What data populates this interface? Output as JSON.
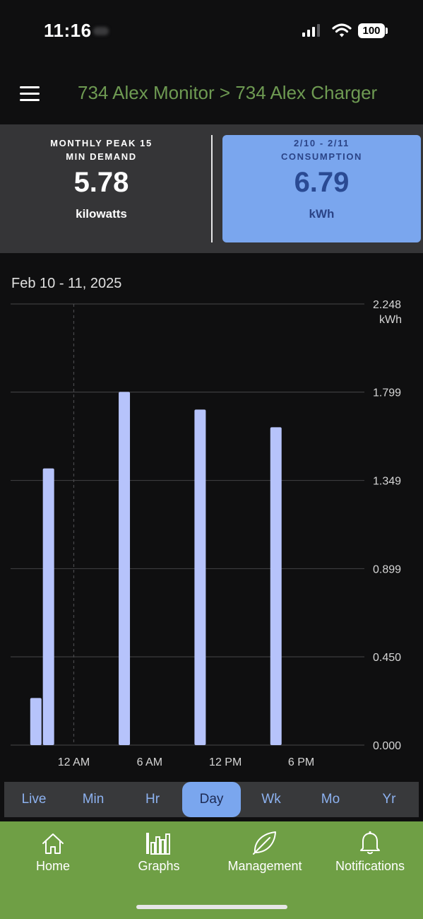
{
  "status_bar": {
    "time": "11:16",
    "battery": "100"
  },
  "header": {
    "title": "734 Alex Monitor > 734 Alex Charger"
  },
  "summary": {
    "left": {
      "label_line1": "MONTHLY PEAK 15",
      "label_line2": "MIN DEMAND",
      "value": "5.78",
      "unit": "kilowatts"
    },
    "right": {
      "label_line1": "2/10 - 2/11",
      "label_line2": "CONSUMPTION",
      "value": "6.79",
      "unit": "kWh"
    }
  },
  "chart_data": {
    "type": "bar",
    "date_range_label": "Feb 10 - 11, 2025",
    "y_unit": "kWh",
    "ylim": [
      0,
      2.248
    ],
    "y_ticks": [
      "0.000",
      "0.450",
      "0.899",
      "1.349",
      "1.799",
      "2.248"
    ],
    "x_ticks": [
      "12 AM",
      "6 AM",
      "12 PM",
      "6 PM"
    ],
    "x_tick_hours": [
      0,
      6,
      12,
      18
    ],
    "x_range_hours": [
      -5,
      23
    ],
    "bars": [
      {
        "hour": -3,
        "value": 0.24
      },
      {
        "hour": -2,
        "value": 1.41
      },
      {
        "hour": 4,
        "value": 1.8
      },
      {
        "hour": 10,
        "value": 1.71
      },
      {
        "hour": 16,
        "value": 1.62
      }
    ],
    "bar_color": "#b6c3fb",
    "grid": true,
    "marker_hour": 0
  },
  "range_tabs": {
    "items": [
      "Live",
      "Min",
      "Hr",
      "Day",
      "Wk",
      "Mo",
      "Yr"
    ],
    "active": "Day"
  },
  "bottom_nav": {
    "home": "Home",
    "graphs": "Graphs",
    "management": "Management",
    "notifications": "Notifications"
  },
  "colors": {
    "accent_green": "#6f9f45",
    "accent_blue": "#7aa6ee",
    "title_green": "#6e9a52"
  }
}
